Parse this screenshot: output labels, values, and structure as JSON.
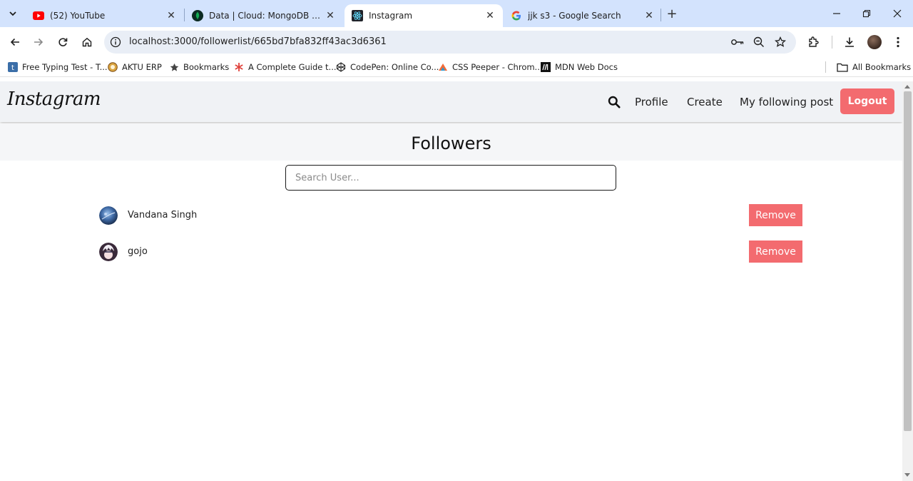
{
  "browser": {
    "tabs": [
      {
        "title": "(52) YouTube",
        "icon": "youtube-icon"
      },
      {
        "title": "Data | Cloud: MongoDB Cloud",
        "icon": "mongodb-icon"
      },
      {
        "title": "Instagram",
        "icon": "react-icon",
        "active": true
      },
      {
        "title": "jjk s3 - Google Search",
        "icon": "google-icon"
      }
    ],
    "url": "localhost:3000/followerlist/665bd7bfa832ff43ac3d6361",
    "bookmarks": [
      {
        "label": "Free Typing Test - T...",
        "icon": "typing-test-icon"
      },
      {
        "label": "AKTU ERP",
        "icon": "aktu-icon"
      },
      {
        "label": "Bookmarks",
        "icon": "star-icon"
      },
      {
        "label": "A Complete Guide t...",
        "icon": "asterisk-icon"
      },
      {
        "label": "CodePen: Online Co...",
        "icon": "codepen-icon"
      },
      {
        "label": "CSS Peeper - Chrom...",
        "icon": "css-peeper-icon"
      },
      {
        "label": "MDN Web Docs",
        "icon": "mdn-icon"
      }
    ],
    "all_bookmarks": "All Bookmarks"
  },
  "app": {
    "logo": "Instagram",
    "nav": {
      "profile": "Profile",
      "create": "Create",
      "following": "My following post",
      "logout": "Logout"
    },
    "heading": "Followers",
    "search_placeholder": "Search User...",
    "followers": [
      {
        "name": "Vandana Singh",
        "button": "Remove"
      },
      {
        "name": "gojo",
        "button": "Remove"
      }
    ],
    "accent_color": "#f36b6f"
  }
}
